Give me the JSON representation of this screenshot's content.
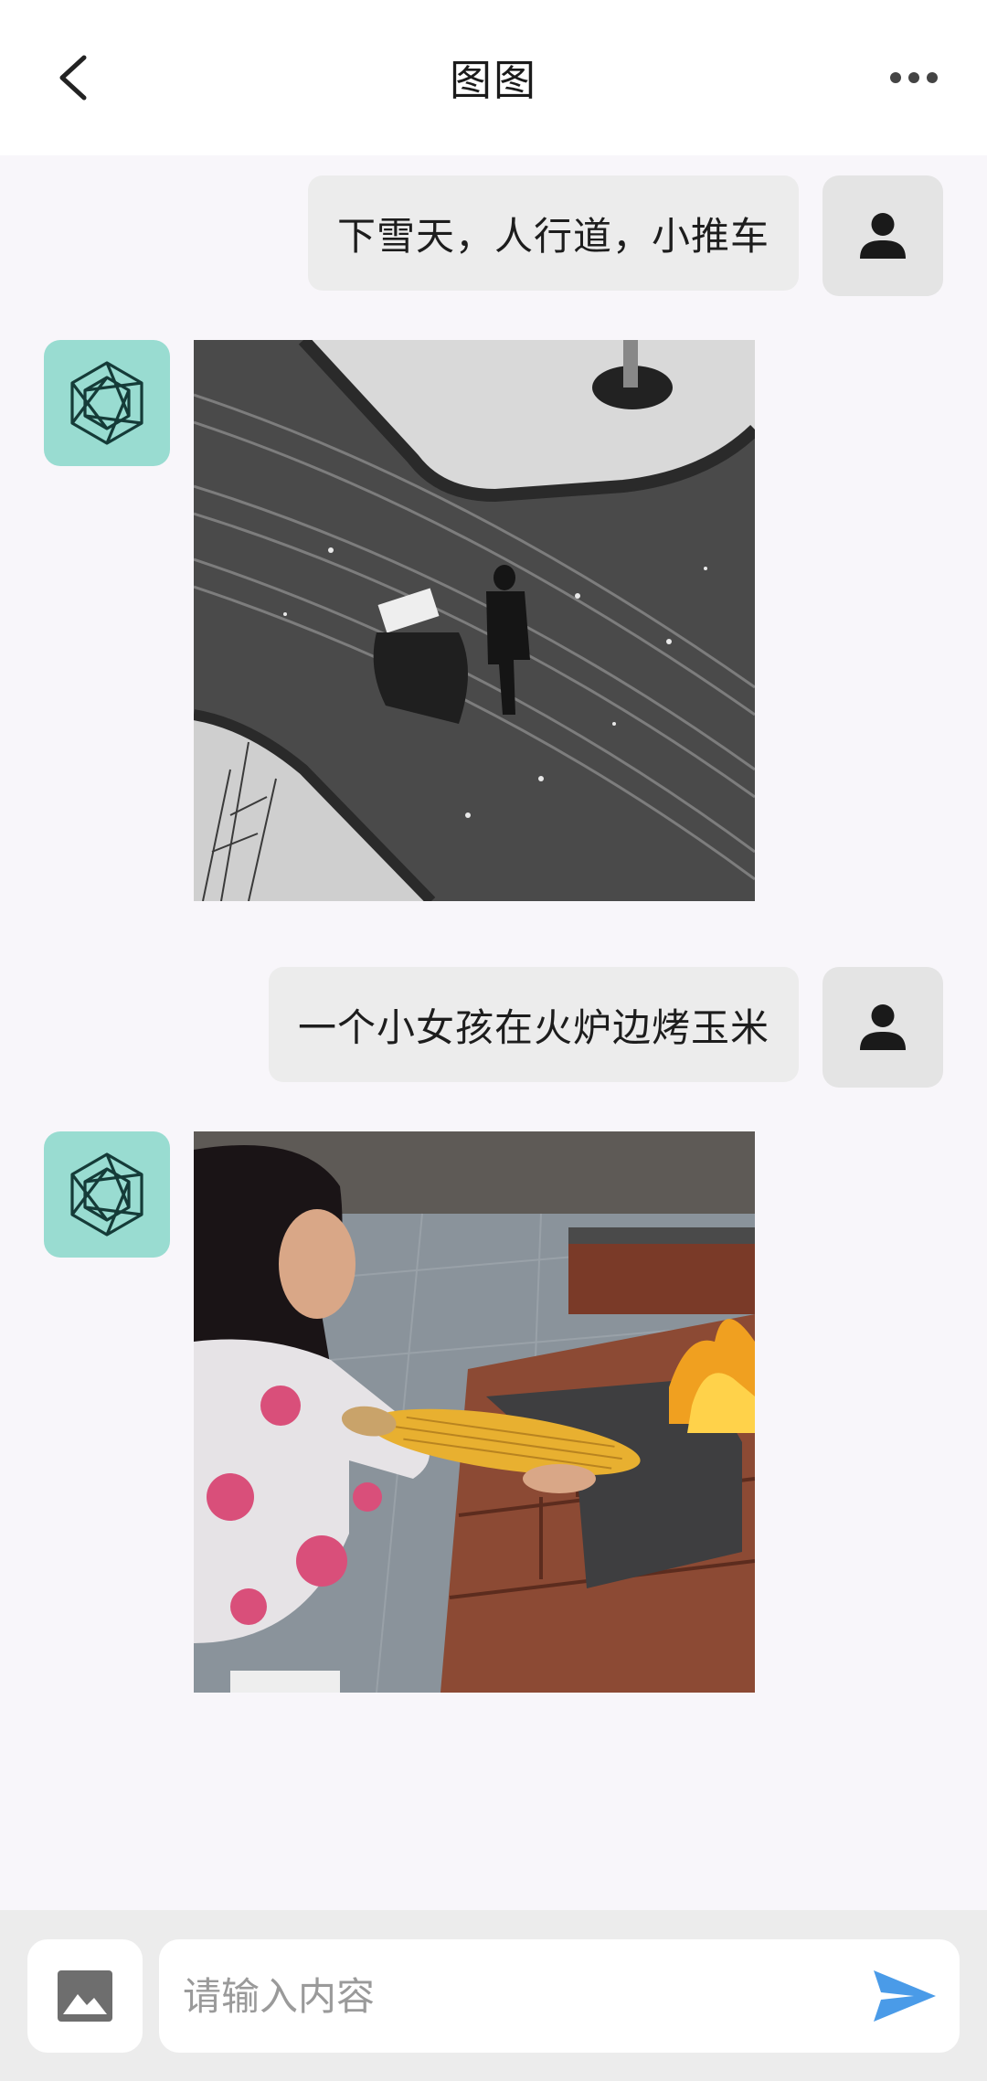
{
  "header": {
    "title": "图图",
    "back_icon": "chevron-left-icon",
    "more_icon": "more-horizontal-icon"
  },
  "messages": [
    {
      "role": "user",
      "text": "下雪天，人行道，小推车",
      "avatar_icon": "person-icon"
    },
    {
      "role": "bot",
      "avatar_icon": "hexagon-logo-icon",
      "image": "snowy-sidewalk-cart"
    },
    {
      "role": "user",
      "text": "一个小女孩在火炉边烤玉米",
      "avatar_icon": "person-icon"
    },
    {
      "role": "bot",
      "avatar_icon": "hexagon-logo-icon",
      "image": "girl-roasting-corn"
    }
  ],
  "input": {
    "placeholder": "请输入内容",
    "image_icon": "image-icon",
    "send_icon": "send-icon"
  },
  "colors": {
    "header_bg": "#ffffff",
    "chat_bg": "#f8f6fa",
    "user_bubble": "#ececec",
    "bot_avatar_bg": "#99dcd1",
    "send_accent": "#4a9be8"
  }
}
